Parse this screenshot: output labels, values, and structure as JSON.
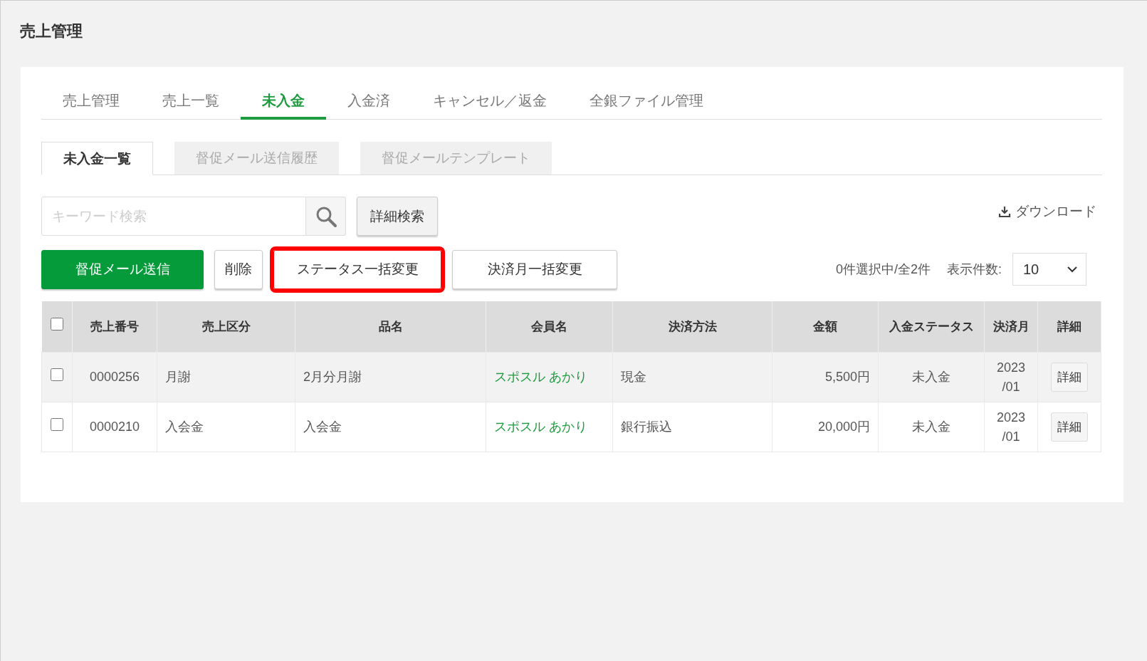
{
  "page_title": "売上管理",
  "tabs": [
    {
      "label": "売上管理",
      "selected": false
    },
    {
      "label": "売上一覧",
      "selected": false
    },
    {
      "label": "未入金",
      "selected": true
    },
    {
      "label": "入金済",
      "selected": false
    },
    {
      "label": "キャンセル／返金",
      "selected": false
    },
    {
      "label": "全銀ファイル管理",
      "selected": false
    }
  ],
  "sub_tabs": [
    {
      "label": "未入金一覧",
      "selected": true
    },
    {
      "label": "督促メール送信履歴",
      "selected": false
    },
    {
      "label": "督促メールテンプレート",
      "selected": false
    }
  ],
  "search": {
    "placeholder": "キーワード検索"
  },
  "advanced_search_button": "詳細検索",
  "download_link": "ダウンロード",
  "actions": [
    {
      "label": "督促メール送信",
      "kind": "primary",
      "highlighted": false
    },
    {
      "label": "削除",
      "kind": "default",
      "highlighted": false
    },
    {
      "label": "ステータス一括変更",
      "kind": "default",
      "highlighted": true
    },
    {
      "label": "決済月一括変更",
      "kind": "default",
      "highlighted": false
    }
  ],
  "selection_count": "0件選択中/全2件",
  "page_size": {
    "label": "表示件数:",
    "value": "10"
  },
  "table": {
    "select_all_checked": false,
    "columns": [
      "売上番号",
      "売上区分",
      "品名",
      "会員名",
      "決済方法",
      "金額",
      "入金ステータス",
      "決済月",
      "詳細"
    ],
    "rows": [
      {
        "checked": false,
        "cells": [
          "0000256",
          "月謝",
          "2月分月謝",
          "スポスル あかり",
          "現金",
          "5,500円",
          "未入金",
          "2023\n/01"
        ],
        "detail_button": "詳細"
      },
      {
        "checked": false,
        "cells": [
          "0000210",
          "入会金",
          "入会金",
          "スポスル あかり",
          "銀行振込",
          "20,000円",
          "未入金",
          "2023\n/01"
        ],
        "detail_button": "詳細"
      }
    ]
  }
}
